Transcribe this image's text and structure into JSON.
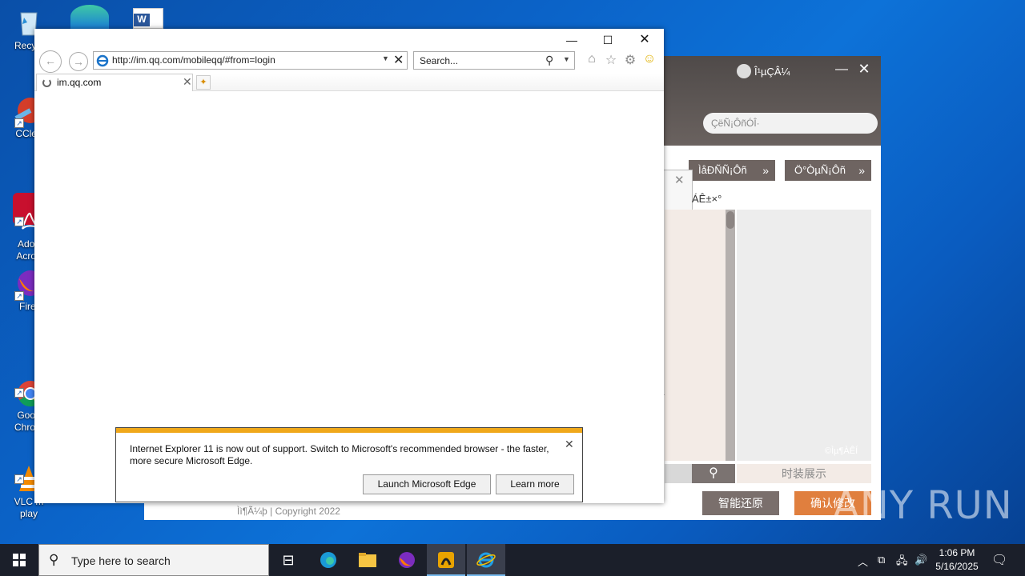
{
  "desktop": {
    "icons": [
      {
        "label": "Recycl",
        "icon": "recycle-bin-icon"
      },
      {
        "label": "CClea",
        "icon": "ccleaner-icon"
      },
      {
        "label": "Adob\nAcrob",
        "icon": "acrobat-icon"
      },
      {
        "label": "Firef",
        "icon": "firefox-icon"
      },
      {
        "label": "Goog\nChrom",
        "icon": "chrome-icon"
      },
      {
        "label": "VLC m\nplay",
        "icon": "vlc-icon"
      }
    ]
  },
  "qq": {
    "user": "Î¹µÇÂ¼",
    "search_placeholder": "ÇëÑ¡ÔñÓÎ·",
    "btn1": "ÌåÐÑÑ¡Ôñ",
    "btn2": "Ö°ÒµÑ¡Ôñ",
    "label": "ÁÊ±×°",
    "watermark": "©Ìµ¶ÀÊÍ",
    "show_label": "时装展示",
    "restore": "智能还原",
    "confirm": "确认修改",
    "copyright": "Ìì¶Ã¼þ | Copyright 2022"
  },
  "ie": {
    "url": "http://im.qq.com/mobileqq/#from=login",
    "search_placeholder": "Search...",
    "tab_title": "im.qq.com",
    "notification": {
      "text": "Internet Explorer 11 is now out of support. Switch to Microsoft's recommended browser - the faster, more secure Microsoft Edge.",
      "launch_label": "Launch Microsoft Edge",
      "learn_label": "Learn more"
    }
  },
  "taskbar": {
    "search_placeholder": "Type here to search",
    "time": "1:06 PM",
    "date": "5/16/2025"
  },
  "watermark": "ANY RUN",
  "colors": {
    "accent_orange": "#e07f3e",
    "ie_bar": "#f0a81a",
    "taskbar": "#1b1f2a"
  }
}
